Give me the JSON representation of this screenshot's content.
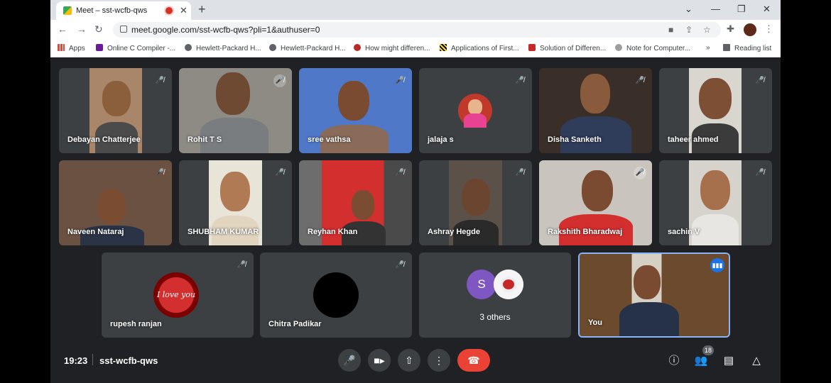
{
  "browser": {
    "tab_title": "Meet – sst-wcfb-qws",
    "url": "meet.google.com/sst-wcfb-qws?pli=1&authuser=0",
    "bookmarks": [
      "Apps",
      "Online C Compiler -...",
      "Hewlett-Packard H...",
      "Hewlett-Packard H...",
      "How might differen...",
      "Applications of First...",
      "Solution of Differen...",
      "Note for Computer..."
    ],
    "bookmarks_more": "»",
    "reading_list": "Reading list"
  },
  "participants": [
    {
      "name": "Debayan Chatterjee"
    },
    {
      "name": "Rohit T S"
    },
    {
      "name": "sree vathsa"
    },
    {
      "name": "jalaja s"
    },
    {
      "name": "Disha Sanketh"
    },
    {
      "name": "taheer ahmed"
    },
    {
      "name": "Naveen Nataraj"
    },
    {
      "name": "SHUBHAM KUMAR"
    },
    {
      "name": "Reyhan Khan"
    },
    {
      "name": "Ashray Hegde"
    },
    {
      "name": "Rakshith Bharadwaj"
    },
    {
      "name": "sachin V"
    },
    {
      "name": "rupesh ranjan",
      "avatar_text": "I love you"
    },
    {
      "name": "Chitra Padikar"
    },
    {
      "name": "3 others",
      "avatar_letter": "S"
    },
    {
      "name": "You"
    }
  ],
  "meeting": {
    "time": "19:23",
    "code": "sst-wcfb-qws",
    "participant_count": "18"
  },
  "colors": {
    "end_call": "#ea4335",
    "tile_bg": "#3c4043",
    "speaking_border": "#8ab4f8",
    "others_avatar": "#7e57c2"
  }
}
